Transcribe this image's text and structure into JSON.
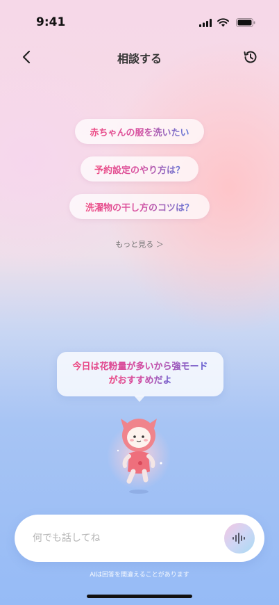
{
  "status_bar": {
    "time": "9:41"
  },
  "nav": {
    "title": "相談する"
  },
  "suggestions": [
    {
      "label": "赤ちゃんの服を洗いたい"
    },
    {
      "label": "予約設定のやり方は？"
    },
    {
      "label": "洗濯物の干し方のコツは？"
    }
  ],
  "see_more": "もっと見る ＞",
  "assistant": {
    "message_line1": "今日は花粉量が多いから強モード",
    "message_line2": "がおすすめだよ"
  },
  "input": {
    "placeholder": "何でも話してね",
    "value": ""
  },
  "disclaimer": "AIは回答を間違えることがあります",
  "colors": {
    "accent_pink": "#ee4d84",
    "accent_blue": "#5f7ad8",
    "background_top": "#f6d8e8",
    "background_bottom": "#96bbf6"
  }
}
